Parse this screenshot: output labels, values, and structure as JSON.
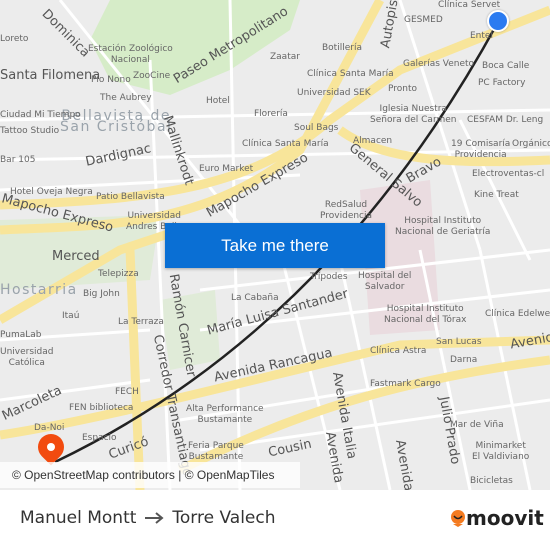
{
  "map": {
    "labels": [
      "Dominica",
      "Estación Zoológico\nNacional",
      "ZooCine",
      "Paseo Metropolitano",
      "Santa Filomena",
      "Pío Nono",
      "The Aubrey",
      "Hotel",
      "Bellavista de\nSan Cristóbal",
      "Mallinkrodt",
      "Dardignac",
      "Euro Market",
      "Hotel Oveja Negra",
      "Patio Bellavista",
      "Mapocho Expreso",
      "Universidad\nAndres Bello",
      "Mapocho Expreso",
      "Clínica Servet",
      "GESMED",
      "Autopista",
      "Botillería",
      "Zaatar",
      "Clínica Santa María",
      "Universidad SEK",
      "Galerías Veneto",
      "Boca Calle",
      "PC Factory",
      "Pronto",
      "Iglesia Nuestra\nSeñora del Carmen",
      "Soul Bags",
      "Clínica Santa María",
      "Almacen",
      "CESFAM Dr. Leng",
      "19 Comisaría\nProvidencia",
      "Orgánico",
      "General Salvo",
      "Bravo",
      "Electroventas-cl",
      "Kine Treat",
      "RedSalud\nProvidencia",
      "Hospital Instituto\nNacional de Geriatría",
      "Merced",
      "Telepizza",
      "Big John",
      "Itaú",
      "La Terraza",
      "PumaLab",
      "Universidad\nCatólica",
      "Ramón Carnicer",
      "Corredor Transantiago",
      "Marcoleta",
      "FEN biblioteca",
      "FECH",
      "Da-Noi",
      "Curicó",
      "Alta Performance\nBustamante",
      "Feria Parque\nBustamante",
      "La Cabaña",
      "María Luisa Santander",
      "Trípodes",
      "Hospital del\nSalvador",
      "Hospital Instituto\nNacional del Tórax",
      "Clínica Edelweiss",
      "Avenida Rancagua",
      "Clínica Astra",
      "San Lucas",
      "Avenida",
      "Darna",
      "Fastmark Cargo",
      "Avenida Italia",
      "Julio Prado",
      "Mar de Viña",
      "Minimarket\nEl Valdiviano",
      "Bicicletas",
      "Cousin",
      "Avenida",
      "Avenida",
      "Entel",
      "Florería",
      "Ciudad Mi Tiempo",
      "Tattoo Studio",
      "Bar 105",
      "Loreto",
      "Hostarria",
      "Espacio"
    ],
    "attribution": "© OpenStreetMap contributors | © OpenMapTiles",
    "cta_button": "Take me there",
    "origin_color": "#2b7bf0",
    "destination_color": "#f24b0f",
    "route_color": "#222222"
  },
  "footer": {
    "origin": "Manuel Montt",
    "arrow_icon": "arrow-right-icon",
    "destination": "Torre Valech",
    "logo_text": "moovit"
  }
}
